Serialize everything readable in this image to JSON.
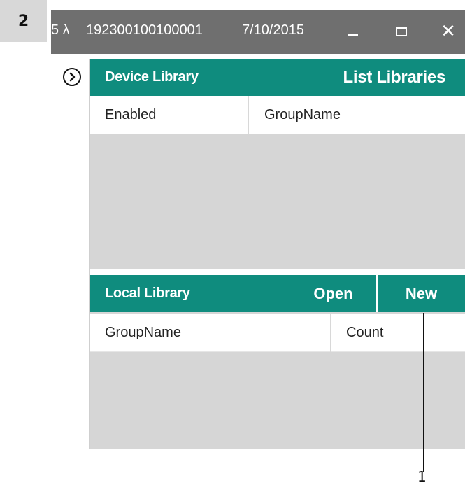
{
  "step_badge": "2",
  "titlebar": {
    "wavelength": "5 λ",
    "serial": "192300100100001",
    "date": "7/10/2015",
    "minimize_icon": "minimize-icon",
    "maximize_icon": "maximize-icon",
    "close_glyph": "✕"
  },
  "sidebar": {
    "expand_icon": "chevron-right-circle-icon"
  },
  "device_library": {
    "title": "Device Library",
    "action": "List Libraries",
    "columns": [
      "Enabled",
      "GroupName"
    ]
  },
  "local_library": {
    "title": "Local Library",
    "open_label": "Open",
    "new_label": "New",
    "columns": [
      "GroupName",
      "Count"
    ]
  },
  "callout": {
    "number": "1"
  },
  "colors": {
    "teal": "#0f8c7e",
    "titlebar": "#6f6f6f",
    "panel_gray": "#d6d6d6"
  }
}
